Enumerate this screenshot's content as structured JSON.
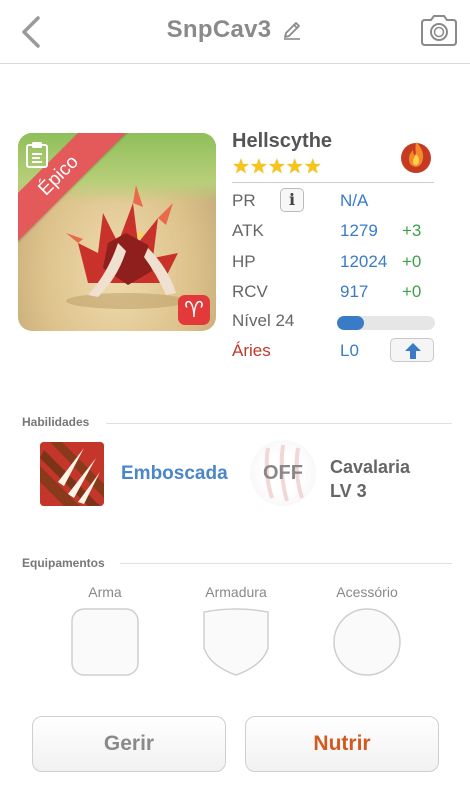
{
  "header": {
    "title": "SnpCav3",
    "back_icon": "chevron-left-icon",
    "edit_icon": "pencil-icon",
    "camera_icon": "camera-icon"
  },
  "hero": {
    "rarity": "Épico",
    "rarity_color": "#e45a5a",
    "zodiac_symbol": "♈",
    "zodiac_color": "#e23a3a"
  },
  "monster": {
    "name": "Hellscythe",
    "stars": "★★★★★",
    "star_count": 5,
    "element_icon": "fire-icon",
    "stats": {
      "pr": {
        "label": "PR",
        "value": "N/A",
        "info_icon": "i"
      },
      "atk": {
        "label": "ATK",
        "value": "1279",
        "bonus": "+3"
      },
      "hp": {
        "label": "HP",
        "value": "12024",
        "bonus": "+0"
      },
      "rcv": {
        "label": "RCV",
        "value": "917",
        "bonus": "+0"
      }
    },
    "level": {
      "label": "Nível 24",
      "progress": 0.28
    },
    "zodiac": {
      "label": "Áries",
      "value": "L0",
      "upgrade_icon": "arrow-up-icon"
    }
  },
  "skills": {
    "title": "Habilidades",
    "active": {
      "name": "Emboscada"
    },
    "passive": {
      "state": "OFF",
      "name": "Cavalaria",
      "level": "LV 3"
    }
  },
  "equipment": {
    "title": "Equipamentos",
    "slots": [
      {
        "label": "Arma"
      },
      {
        "label": "Armadura"
      },
      {
        "label": "Acessório"
      }
    ]
  },
  "actions": {
    "manage": "Gerir",
    "feed": "Nutrir"
  },
  "colors": {
    "accent_blue": "#3a7bc8",
    "bonus_green": "#3fa04a",
    "feed_orange": "#d15a20"
  }
}
